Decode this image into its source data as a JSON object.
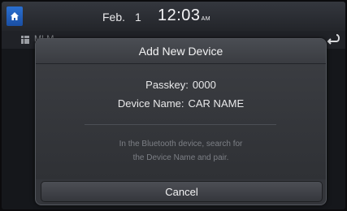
{
  "status_bar": {
    "month": "Feb.",
    "day": "1",
    "time": "12:03",
    "ampm": "AM"
  },
  "background": {
    "title": "MLM"
  },
  "dialog": {
    "title": "Add New Device",
    "passkey_label": "Passkey:",
    "passkey_value": "0000",
    "device_name_label": "Device Name:",
    "device_name_value": "CAR NAME",
    "hint_line1": "In the Bluetooth device, search for",
    "hint_line2": "the Device Name and pair.",
    "cancel_label": "Cancel"
  },
  "icons": {
    "home": "home-icon",
    "menu": "grid-menu-icon",
    "back": "back-arrow-icon"
  },
  "colors": {
    "home_button": "#1f5fbf",
    "dialog_bg": "#34363b",
    "hint_text": "#7c7f85"
  }
}
